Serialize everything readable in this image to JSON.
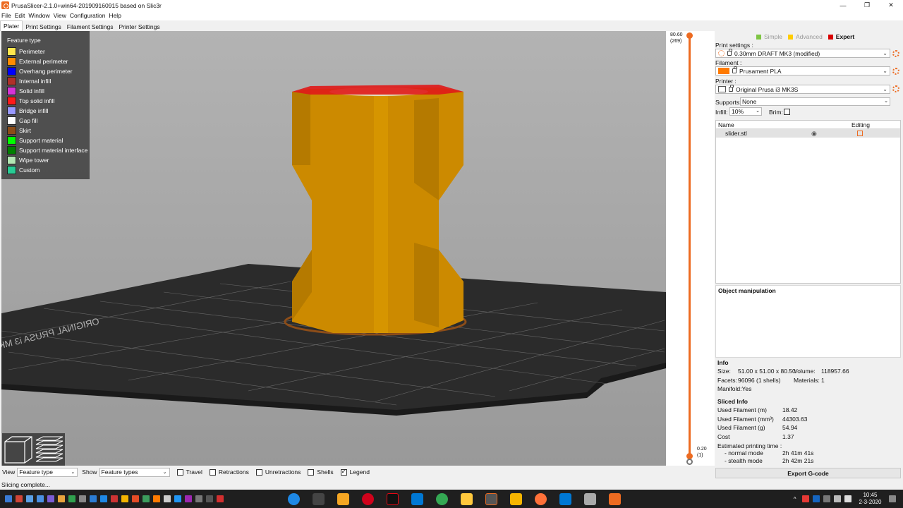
{
  "window": {
    "title": "PrusaSlicer-2.1.0+win64-201909160915 based on Slic3r",
    "controls": {
      "minimize": "—",
      "restore": "❐",
      "close": "✕"
    }
  },
  "menu": [
    "File",
    "Edit",
    "Window",
    "View",
    "Configuration",
    "Help"
  ],
  "tabs": [
    "Plater",
    "Print Settings",
    "Filament Settings",
    "Printer Settings"
  ],
  "legend": {
    "title": "Feature type",
    "items": [
      {
        "label": "Perimeter",
        "color": "#ffe64d"
      },
      {
        "label": "External perimeter",
        "color": "#ff8c00"
      },
      {
        "label": "Overhang perimeter",
        "color": "#0000ff"
      },
      {
        "label": "Internal infill",
        "color": "#b03029"
      },
      {
        "label": "Solid infill",
        "color": "#d633d6"
      },
      {
        "label": "Top solid infill",
        "color": "#ff1a1a"
      },
      {
        "label": "Bridge infill",
        "color": "#9999ff"
      },
      {
        "label": "Gap fill",
        "color": "#ffffff"
      },
      {
        "label": "Skirt",
        "color": "#8c4d19"
      },
      {
        "label": "Support material",
        "color": "#00ff00"
      },
      {
        "label": "Support material interface",
        "color": "#008000"
      },
      {
        "label": "Wipe tower",
        "color": "#b3e6b3"
      },
      {
        "label": "Custom",
        "color": "#28cc94"
      }
    ]
  },
  "layer_slider": {
    "top_height": "80.60",
    "top_layer": "(269)",
    "bottom_height": "0.20",
    "bottom_layer": "(1)"
  },
  "modes": [
    {
      "label": "Simple",
      "color": "#7ec543",
      "active": false
    },
    {
      "label": "Advanced",
      "color": "#ffcc00",
      "active": false
    },
    {
      "label": "Expert",
      "color": "#d90000",
      "active": true
    }
  ],
  "settings": {
    "print_label": "Print settings :",
    "print_value": "0.30mm DRAFT MK3 (modified)",
    "filament_label": "Filament :",
    "filament_value": "Prusament PLA",
    "filament_color": "#ff7a00",
    "printer_label": "Printer :",
    "printer_value": "Original Prusa i3 MK3S",
    "supports_label": "Supports:",
    "supports_value": "None",
    "infill_label": "Infill:",
    "infill_value": "10%",
    "brim_label": "Brim:"
  },
  "object_list": {
    "col_name": "Name",
    "col_editing": "Editing",
    "rows": [
      {
        "name": "slider.stl"
      }
    ]
  },
  "object_manipulation": {
    "title": "Object manipulation"
  },
  "info": {
    "title": "Info",
    "size_label": "Size:",
    "size_value": "51.00 x 51.00 x 80.50",
    "volume_label": "Volume:",
    "volume_value": "118957.66",
    "facets_label": "Facets:",
    "facets_value": "96096 (1 shells)",
    "materials_label": "Materials:",
    "materials_value": "1",
    "manifold": "Manifold:Yes"
  },
  "sliced_info": {
    "title": "Sliced Info",
    "rows": [
      {
        "label": "Used Filament (m)",
        "value": "18.42"
      },
      {
        "label": "Used Filament (mm³)",
        "value": "44303.63"
      },
      {
        "label": "Used Filament (g)",
        "value": "54.94"
      },
      {
        "label": "Cost",
        "value": "1.37"
      }
    ],
    "time_title": "Estimated printing time :",
    "normal_label": "- normal mode",
    "normal_value": "2h 41m 41s",
    "stealth_label": "- stealth mode",
    "stealth_value": "2h 42m 21s"
  },
  "export_button": "Export G-code",
  "bottom_bar": {
    "view_label": "View",
    "view_value": "Feature type",
    "show_label": "Show",
    "show_value": "Feature types",
    "checks": [
      {
        "label": "Travel",
        "checked": false
      },
      {
        "label": "Retractions",
        "checked": false
      },
      {
        "label": "Unretractions",
        "checked": false
      },
      {
        "label": "Shells",
        "checked": false
      },
      {
        "label": "Legend",
        "checked": true
      }
    ]
  },
  "status": "Slicing complete...",
  "taskbar": {
    "time": "10:45",
    "date": "2-3-2020"
  }
}
